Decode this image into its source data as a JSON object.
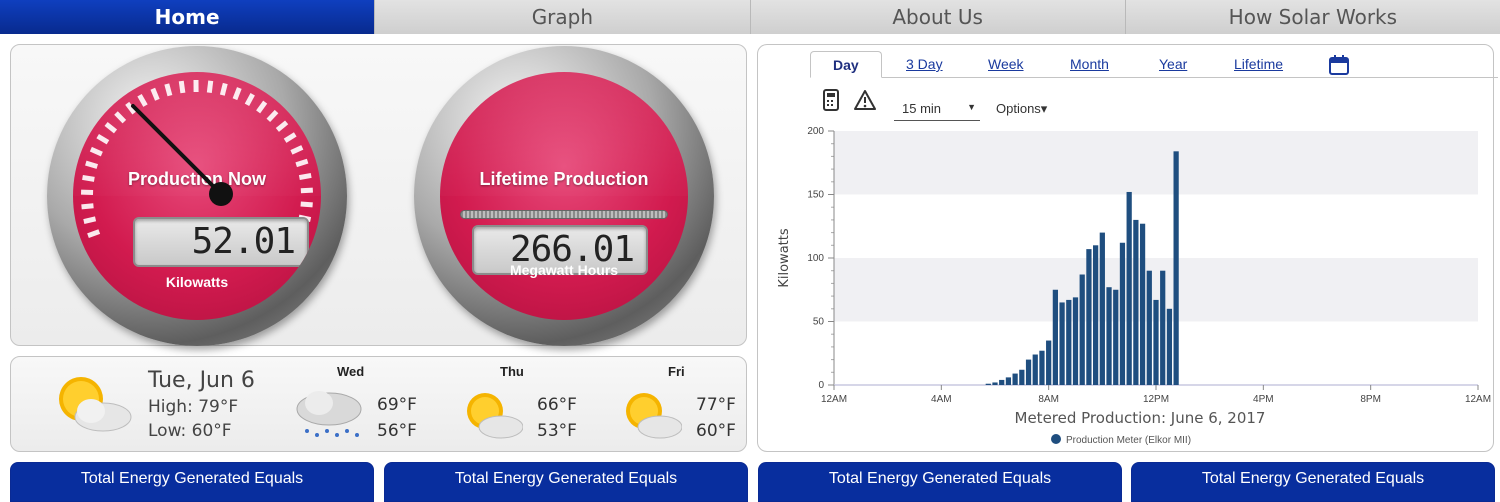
{
  "nav": {
    "tabs": [
      {
        "label": "Home",
        "active": true
      },
      {
        "label": "Graph",
        "active": false
      },
      {
        "label": "About Us",
        "active": false
      },
      {
        "label": "How Solar Works",
        "active": false
      }
    ]
  },
  "production_now": {
    "title": "Production Now",
    "value": "52.01",
    "unit": "Kilowatts"
  },
  "lifetime_production": {
    "title": "Lifetime Production",
    "value": "266.01",
    "unit": "Megawatt Hours"
  },
  "weather": {
    "today": {
      "date": "Tue, Jun 6",
      "high": "High: 79°F",
      "low": "Low: 60°F",
      "icon": "partly-sunny-icon"
    },
    "forecast": [
      {
        "day": "Wed",
        "high": "69°F",
        "low": "56°F",
        "icon": "rain-cloud-icon"
      },
      {
        "day": "Thu",
        "high": "66°F",
        "low": "53°F",
        "icon": "partly-sunny-icon"
      },
      {
        "day": "Fri",
        "high": "77°F",
        "low": "60°F",
        "icon": "partly-sunny-icon"
      }
    ]
  },
  "chart_tabs": [
    {
      "label": "Day",
      "active": true
    },
    {
      "label": "3 Day",
      "active": false
    },
    {
      "label": "Week",
      "active": false
    },
    {
      "label": "Month",
      "active": false
    },
    {
      "label": "Year",
      "active": false
    },
    {
      "label": "Lifetime",
      "active": false
    }
  ],
  "chart_toolbar": {
    "interval": "15 min",
    "options": "Options▾"
  },
  "chart_data": {
    "type": "bar",
    "title": "Metered Production: June 6, 2017",
    "xlabel": "",
    "ylabel": "Kilowatts",
    "ylim": [
      0,
      200
    ],
    "yticks": [
      0,
      50,
      100,
      150,
      200
    ],
    "xlim_hours": [
      0,
      24
    ],
    "xticks": [
      "12AM",
      "4AM",
      "8AM",
      "12PM",
      "4PM",
      "8PM",
      "12AM"
    ],
    "legend": "bottom-center",
    "series": [
      {
        "name": "Production Meter (Elkor MII)",
        "color": "#1f4e7f",
        "x_hours": [
          5.75,
          6.0,
          6.25,
          6.5,
          6.75,
          7.0,
          7.25,
          7.5,
          7.75,
          8.0,
          8.25,
          8.5,
          8.75,
          9.0,
          9.25,
          9.5,
          9.75,
          10.0,
          10.25,
          10.5,
          10.75,
          11.0,
          11.25,
          11.5,
          11.75,
          12.0,
          12.25,
          12.5,
          12.75
        ],
        "values": [
          1,
          2,
          4,
          6,
          9,
          12,
          20,
          24,
          27,
          35,
          75,
          65,
          67,
          69,
          87,
          107,
          110,
          120,
          77,
          75,
          112,
          152,
          130,
          127,
          90,
          67,
          90,
          60,
          184
        ]
      }
    ]
  },
  "bottom_cards": [
    {
      "label": "Total Energy Generated Equals"
    },
    {
      "label": "Total Energy Generated Equals"
    },
    {
      "label": "Total Energy Generated Equals"
    },
    {
      "label": "Total Energy Generated Equals"
    }
  ],
  "colors": {
    "nav_active": "#0a34a8",
    "gauge_face": "#d21b4f",
    "bar": "#1f4e7f",
    "card_header": "#082e9e"
  }
}
